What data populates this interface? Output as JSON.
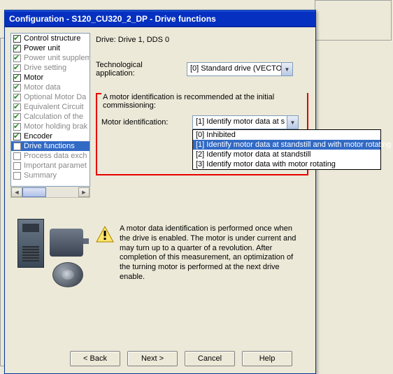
{
  "window": {
    "title": "Configuration - S120_CU320_2_DP - Drive functions"
  },
  "nav": {
    "items": [
      {
        "label": "Control structure",
        "checked": true,
        "active": true
      },
      {
        "label": "Power unit",
        "checked": true,
        "active": true
      },
      {
        "label": "Power unit supplem",
        "checked": true,
        "active": false
      },
      {
        "label": "Drive setting",
        "checked": true,
        "active": false
      },
      {
        "label": "Motor",
        "checked": true,
        "active": true
      },
      {
        "label": "Motor data",
        "checked": true,
        "active": false
      },
      {
        "label": "Optional Motor Da",
        "checked": true,
        "active": false
      },
      {
        "label": "Equivalent Circuit",
        "checked": true,
        "active": false
      },
      {
        "label": "Calculation of the",
        "checked": true,
        "active": false
      },
      {
        "label": "Motor holding brak",
        "checked": true,
        "active": false
      },
      {
        "label": "Encoder",
        "checked": true,
        "active": true
      },
      {
        "label": "Drive functions",
        "checked": false,
        "active": false,
        "selected": true
      },
      {
        "label": "Process data exch",
        "checked": false,
        "active": false
      },
      {
        "label": "Important paramet",
        "checked": false,
        "active": false
      },
      {
        "label": "Summary",
        "checked": false,
        "active": false
      }
    ]
  },
  "content": {
    "drive": "Drive: Drive 1, DDS 0",
    "tech_label": "Technological application:",
    "tech_value": "[0] Standard drive (VECTOR",
    "group_label": "A motor identification is recommended at the initial commissioning:",
    "motor_id_label": "Motor identification:",
    "motor_id_value": "[1] Identify motor data at s",
    "options": [
      "[0] Inhibited",
      "[1] Identify motor data at standstill and with motor rotating",
      "[2] Identify motor data at standstill",
      "[3] Identify motor data with motor rotating"
    ],
    "info": "A motor data identification is performed once when the drive is enabled. The motor is under current and may turn up to a quarter of a revolution. After completion of this measurement, an optimization of the turning motor is performed at the next drive enable."
  },
  "buttons": {
    "back": "< Back",
    "next": "Next >",
    "cancel": "Cancel",
    "help": "Help"
  }
}
